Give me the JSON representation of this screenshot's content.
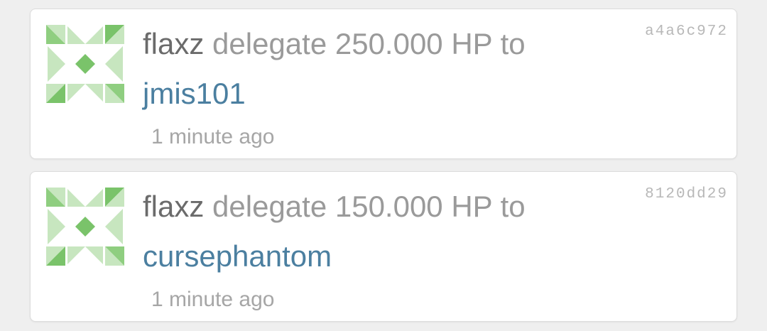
{
  "operations": [
    {
      "id": "a4a6c972",
      "actor": "flaxz",
      "action_text": "delegate 250.000 HP to",
      "target": "jmis101",
      "time": "1 minute ago"
    },
    {
      "id": "8120dd29",
      "actor": "flaxz",
      "action_text": "delegate 150.000 HP to",
      "target": "cursephantom",
      "time": "1 minute ago"
    }
  ],
  "colors": {
    "avatar_dark": "#7ac36a",
    "avatar_light": "#c7e6bf",
    "link": "#4b7fa0",
    "actor": "#6b6b6b",
    "muted": "#9a9a9a"
  },
  "icons": {
    "avatar": "identicon-avatar-icon"
  }
}
